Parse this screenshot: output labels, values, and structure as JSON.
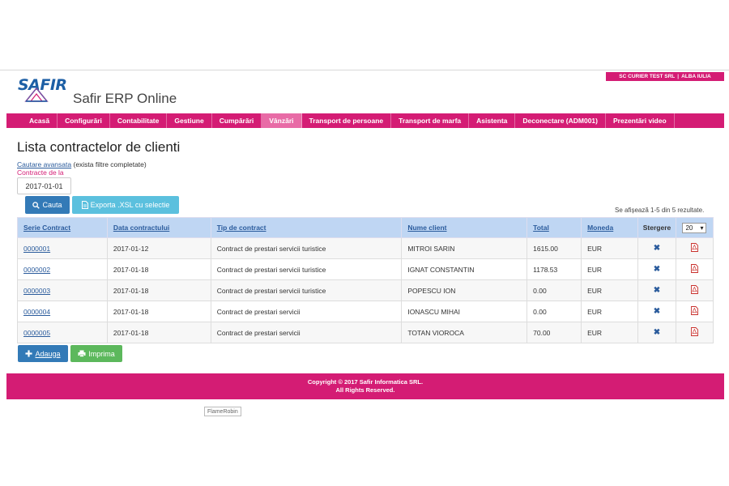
{
  "header": {
    "company": "SC CURIER TEST SRL",
    "location": "ALBA IULIA",
    "logo_text": "SAFIR",
    "app_title": "Safir ERP Online"
  },
  "nav": {
    "items": [
      "Acasă",
      "Configurări",
      "Contabilitate",
      "Gestiune",
      "Cumpărări",
      "Vânzări",
      "Transport de persoane",
      "Transport de marfa",
      "Asistenta",
      "Deconectare (ADM001)",
      "Prezentări video"
    ],
    "active": "Vânzări"
  },
  "page": {
    "title": "Lista contractelor de clienti",
    "advanced_search_link": "Cautare avansata",
    "advanced_search_note": "(exista filtre completate)",
    "filter_label": "Contracte de la",
    "filter_value": "2017-01-01",
    "search_button": "Cauta",
    "export_button": "Exporta .XSL cu selectie",
    "results_info": "Se afișează 1-5 din 5 rezultate."
  },
  "table": {
    "headers": {
      "serie": "Serie Contract",
      "data": "Data contractului",
      "tip": "Tip de contract",
      "client": "Nume client",
      "total": "Total",
      "moneda": "Moneda",
      "stergere": "Stergere"
    },
    "page_size": "20",
    "rows": [
      {
        "serie": "0000001",
        "data": "2017-01-12",
        "tip": "Contract de prestari servicii turistice",
        "client": "MITROI SARIN",
        "total": "1615.00",
        "moneda": "EUR"
      },
      {
        "serie": "0000002",
        "data": "2017-01-18",
        "tip": "Contract de prestari servicii turistice",
        "client": "IGNAT CONSTANTIN",
        "total": "1178.53",
        "moneda": "EUR"
      },
      {
        "serie": "0000003",
        "data": "2017-01-18",
        "tip": "Contract de prestari servicii turistice",
        "client": "POPESCU ION",
        "total": "0.00",
        "moneda": "EUR"
      },
      {
        "serie": "0000004",
        "data": "2017-01-18",
        "tip": "Contract de prestari servicii",
        "client": "IONASCU MIHAI",
        "total": "0.00",
        "moneda": "EUR"
      },
      {
        "serie": "0000005",
        "data": "2017-01-18",
        "tip": "Contract de prestari servicii",
        "client": "TOTAN VIOROCA",
        "total": "70.00",
        "moneda": "EUR"
      }
    ]
  },
  "actions": {
    "add_button": "Adauga",
    "print_button": "Imprima"
  },
  "footer": {
    "line1": "Copyright © 2017 Safir Informatica SRL.",
    "line2": "All Rights Reserved."
  },
  "taskbar": {
    "flame_label": "FlameRobin"
  },
  "colors": {
    "brand": "#d41c74",
    "nav_active": "#e86ba6",
    "table_header": "#bfd6f3",
    "link": "#2a5b9c",
    "primary_button": "#337ab7",
    "info_button": "#5bc0de",
    "success_button": "#5cb85c"
  },
  "icons": {
    "search": "search-icon",
    "export": "file-icon",
    "delete": "x-icon",
    "pdf": "pdf-icon",
    "add": "plus-icon",
    "print": "print-icon",
    "dropdown": "chevron-down-icon"
  }
}
